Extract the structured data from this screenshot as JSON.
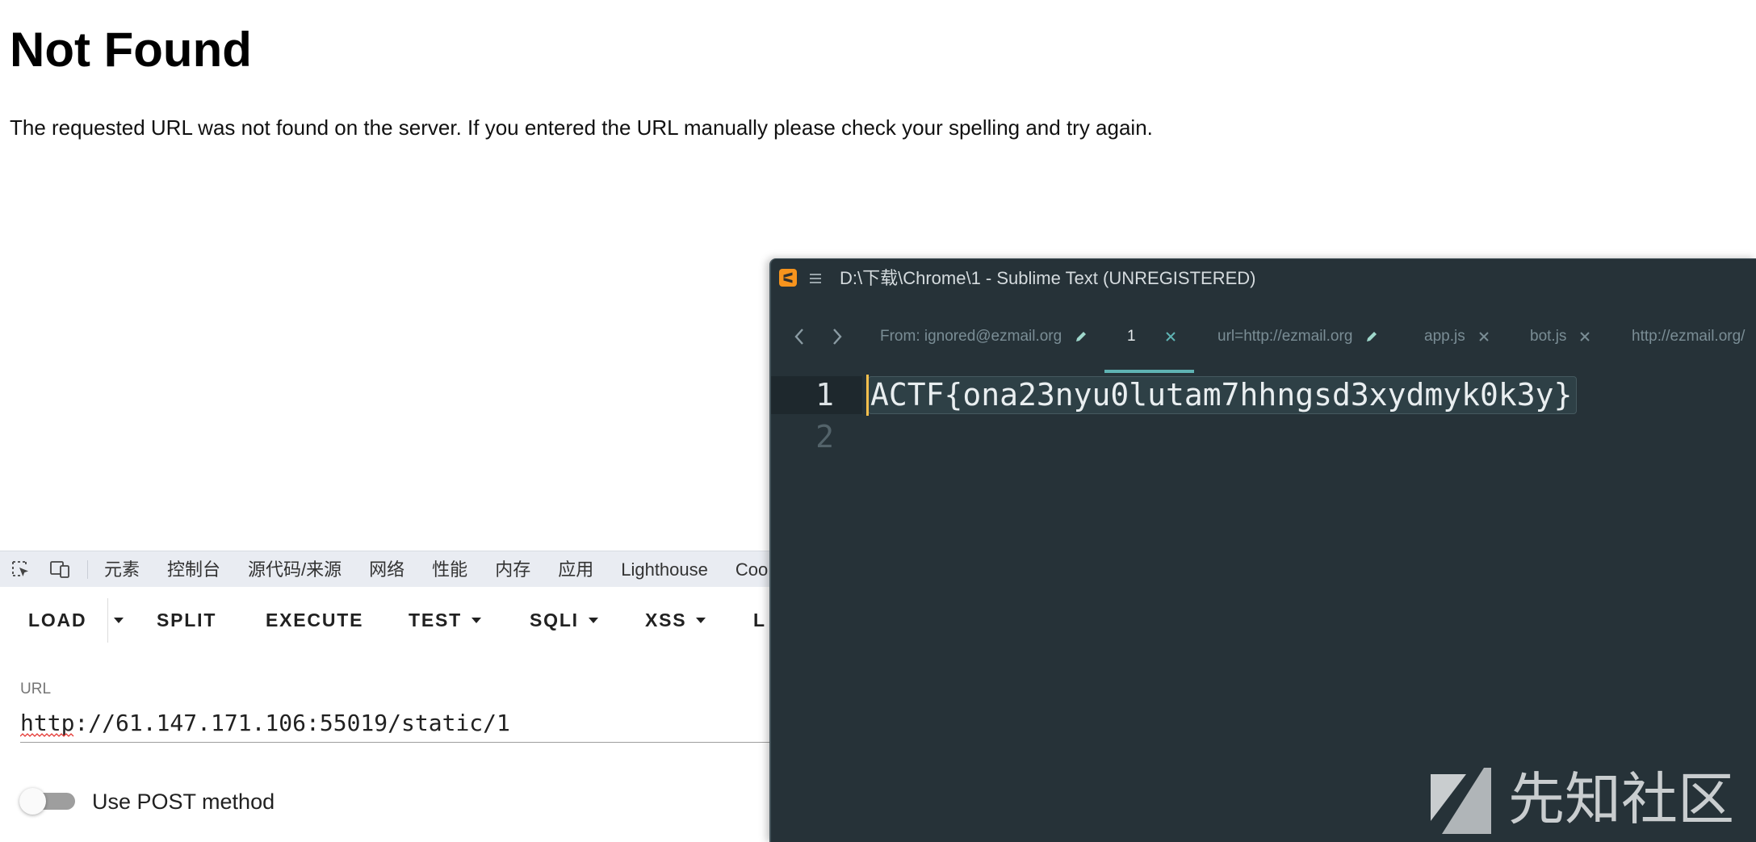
{
  "page": {
    "title": "Not Found",
    "message": "The requested URL was not found on the server. If you entered the URL manually please check your spelling and try again."
  },
  "devtools": {
    "inspect_icon": "inspect-element-icon",
    "device_icon": "device-toolbar-icon",
    "tabs": [
      {
        "label": "元素"
      },
      {
        "label": "控制台"
      },
      {
        "label": "源代码/来源"
      },
      {
        "label": "网络"
      },
      {
        "label": "性能"
      },
      {
        "label": "内存"
      },
      {
        "label": "应用"
      },
      {
        "label": "Lighthouse"
      },
      {
        "label": "Coo"
      }
    ]
  },
  "hackbar": {
    "buttons": [
      {
        "label": "LOAD",
        "dropdown": false
      },
      {
        "label": "SPLIT",
        "dropdown": false
      },
      {
        "label": "EXECUTE",
        "dropdown": false
      },
      {
        "label": "TEST",
        "dropdown": true
      },
      {
        "label": "SQLI",
        "dropdown": true
      },
      {
        "label": "XSS",
        "dropdown": true
      },
      {
        "label": "L",
        "dropdown": false
      }
    ],
    "load_menu_icon": "caret-down-icon",
    "url_label": "URL",
    "url_value": "http://61.147.171.106:55019/static/1",
    "post_toggle": {
      "label": "Use POST method",
      "checked": false
    }
  },
  "sublime": {
    "title": "D:\\下载\\Chrome\\1 - Sublime Text (UNREGISTERED)",
    "app_icon": "sublime-text-icon",
    "menu_icon": "hamburger-menu-icon",
    "tabs": [
      {
        "label": "From: ignored@ezmail.org",
        "active": false,
        "icon": "pencil-icon"
      },
      {
        "label": "1",
        "active": true,
        "icon": "close-icon"
      },
      {
        "label": "url=http://ezmail.org",
        "active": false,
        "icon": "pencil-icon"
      },
      {
        "label": "app.js",
        "active": false,
        "icon": "close-icon"
      },
      {
        "label": "bot.js",
        "active": false,
        "icon": "close-icon"
      },
      {
        "label": "http://ezmail.org/",
        "active": false
      }
    ],
    "lines": [
      {
        "number": "1",
        "text": "ACTF{ona23nyu0lutam7hhngsd3xydmyk0k3y}"
      },
      {
        "number": "2"
      }
    ],
    "colors": {
      "background": "#263238",
      "accent": "#5fb3b3",
      "cursor": "#f9c04d",
      "app_icon": "#f7941d"
    }
  },
  "watermark": {
    "text": "先知社区",
    "icon": "xianzhi-logo-icon"
  }
}
